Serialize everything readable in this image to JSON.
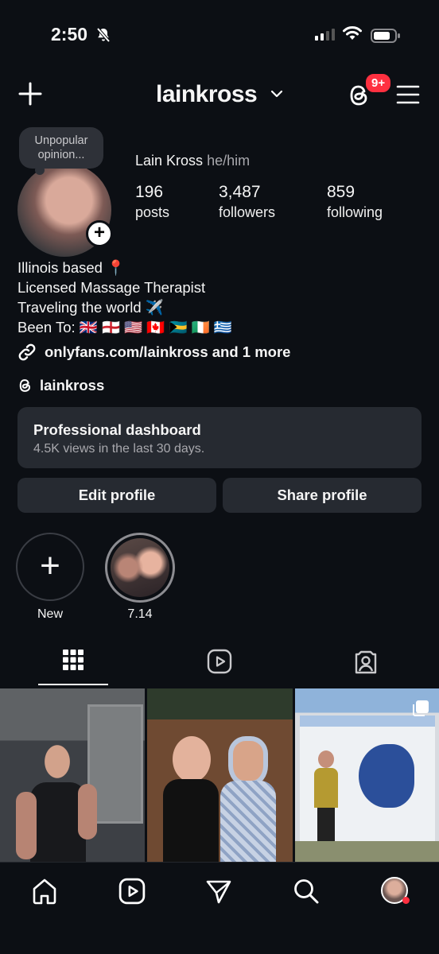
{
  "status_bar": {
    "time": "2:50"
  },
  "header": {
    "username": "lainkross",
    "notifications_badge": "9+"
  },
  "profile": {
    "note": "Unpopular opinion...",
    "full_name": "Lain Kross",
    "pronouns": "he/him",
    "stats": [
      {
        "value": "196",
        "label": "posts"
      },
      {
        "value": "3,487",
        "label": "followers"
      },
      {
        "value": "859",
        "label": "following"
      }
    ],
    "bio": [
      "Illinois based 📍",
      "Licensed Massage Therapist",
      "Traveling the world ✈️",
      "Been To: 🇬🇧 🏴󠁧󠁢󠁥󠁮󠁧󠁿 🇺🇸 🇨🇦 🇧🇸 🇮🇪 🇬🇷"
    ],
    "link": "onlyfans.com/lainkross and 1 more",
    "threads_handle": "lainkross"
  },
  "dashboard": {
    "title": "Professional dashboard",
    "subtitle": "4.5K views in the last 30 days."
  },
  "buttons": {
    "edit": "Edit profile",
    "share": "Share profile"
  },
  "highlights": [
    {
      "label": "New"
    },
    {
      "label": "7.14"
    }
  ],
  "tabs": [
    "grid-icon",
    "reels-icon",
    "tagged-icon"
  ],
  "nav": [
    "home-icon",
    "reels-icon",
    "send-icon",
    "search-icon",
    "profile-avatar"
  ],
  "colors": {
    "background": "#0c0f14",
    "card": "#262a31",
    "badge": "#ff3040",
    "secondary_text": "#a8a8ad"
  }
}
